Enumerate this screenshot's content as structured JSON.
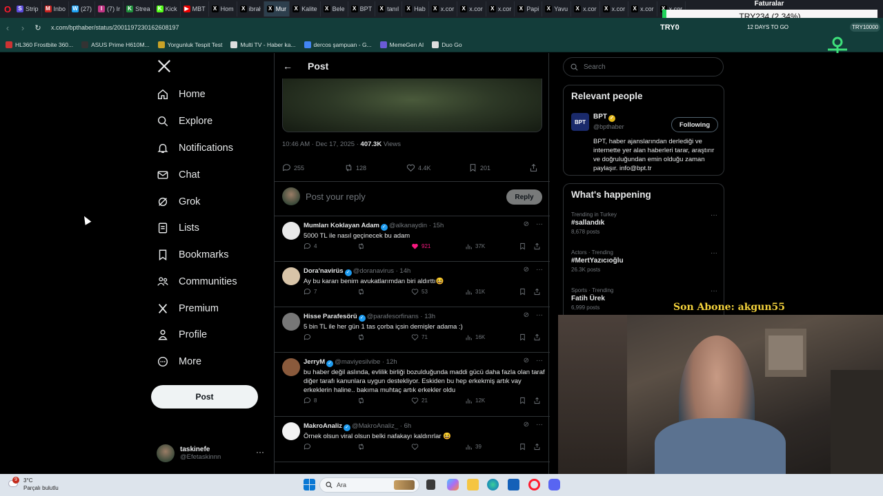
{
  "browser": {
    "tabs": [
      {
        "label": "Strip",
        "color": "#5b4bdb",
        "glyph": "S"
      },
      {
        "label": "Inbo",
        "color": "#c5221f",
        "glyph": "M"
      },
      {
        "label": "(27)",
        "color": "#1da1f2",
        "glyph": "W"
      },
      {
        "label": "(7) Ir",
        "color": "#c13584",
        "glyph": "I"
      },
      {
        "label": "Strea",
        "color": "#1f8f3a",
        "glyph": "K"
      },
      {
        "label": "Kick",
        "color": "#53fc18",
        "glyph": "K"
      },
      {
        "label": "MBT",
        "color": "#e00",
        "glyph": "▶"
      },
      {
        "label": "Hom",
        "color": "#000",
        "glyph": "X"
      },
      {
        "label": "ibrał",
        "color": "#000",
        "glyph": "X"
      },
      {
        "label": "Mur",
        "color": "#000",
        "glyph": "X"
      },
      {
        "label": "Kalite",
        "color": "#000",
        "glyph": "X"
      },
      {
        "label": "Bele",
        "color": "#000",
        "glyph": "X"
      },
      {
        "label": "BPT",
        "color": "#000",
        "glyph": "X"
      },
      {
        "label": "tanıl",
        "color": "#000",
        "glyph": "X"
      },
      {
        "label": "Hab",
        "color": "#000",
        "glyph": "X"
      },
      {
        "label": "x.cor",
        "color": "#000",
        "glyph": "X"
      },
      {
        "label": "x.cor",
        "color": "#000",
        "glyph": "X"
      },
      {
        "label": "x.cor",
        "color": "#000",
        "glyph": "X"
      },
      {
        "label": "Papi",
        "color": "#000",
        "glyph": "X"
      },
      {
        "label": "Yavu",
        "color": "#000",
        "glyph": "X"
      },
      {
        "label": "x.cor",
        "color": "#000",
        "glyph": "X"
      },
      {
        "label": "x.cor",
        "color": "#000",
        "glyph": "X"
      },
      {
        "label": "x.cor",
        "color": "#000",
        "glyph": "X"
      },
      {
        "label": "x.cor",
        "color": "#000",
        "glyph": "X"
      }
    ],
    "active_tab_index": 9,
    "url": "x.com/bpthaber/status/2001197230162608197",
    "bookmarks": [
      {
        "label": "HL360 Frostbite 360...",
        "color": "#c33"
      },
      {
        "label": "ASUS Prime H610M...",
        "color": "#333"
      },
      {
        "label": "Yorgunluk Tespit Test",
        "color": "#c9a227"
      },
      {
        "label": "Multi TV - Haber ka...",
        "color": "#ddd"
      },
      {
        "label": "dercos şampuan - G...",
        "color": "#4285f4"
      },
      {
        "label": "MemeGen AI",
        "color": "#6b5bd6"
      },
      {
        "label": "Duo Go",
        "color": "#ddd"
      }
    ]
  },
  "overlay": {
    "faturalar": "Faturalar",
    "ticker": "TRY234 (2.34%)",
    "tryo": "TRY0",
    "days_to_go": "12 DAYS TO GO",
    "try_rate": "TRY10000",
    "son_abone": "Son Abone: akgun55"
  },
  "sidebar": {
    "items": [
      {
        "label": "Home",
        "icon": "home-icon"
      },
      {
        "label": "Explore",
        "icon": "search-icon"
      },
      {
        "label": "Notifications",
        "icon": "bell-icon"
      },
      {
        "label": "Chat",
        "icon": "mail-icon"
      },
      {
        "label": "Grok",
        "icon": "grok-icon"
      },
      {
        "label": "Lists",
        "icon": "list-icon"
      },
      {
        "label": "Bookmarks",
        "icon": "bookmark-icon"
      },
      {
        "label": "Communities",
        "icon": "people-icon"
      },
      {
        "label": "Premium",
        "icon": "x-icon"
      },
      {
        "label": "Profile",
        "icon": "person-icon"
      },
      {
        "label": "More",
        "icon": "more-circle-icon"
      }
    ],
    "post_label": "Post",
    "account": {
      "name": "taskinefe",
      "handle": "@Efetaskinnn"
    }
  },
  "post": {
    "header": "Post",
    "time": "10:46 AM · Dec 17, 2025 · ",
    "views_count": "407.3K",
    "views_label": " Views",
    "replies": "255",
    "reposts": "128",
    "likes": "4.4K",
    "bookmarks": "201",
    "reply_placeholder": "Post your reply",
    "reply_button": "Reply"
  },
  "replies": [
    {
      "name": "Mumları Koklayan Adam",
      "handle": "@alkanaydin · 15h",
      "text": "5000 TL ile nasıl geçinecek bu adam",
      "comments": "4",
      "reposts": "",
      "likes": "921",
      "liked": true,
      "views": "37K",
      "avatar_color": "#e9e9e9"
    },
    {
      "name": "Dora'navirüs",
      "handle": "@doranavirus · 14h",
      "text": "Ay bu kararı benim avukatlarımdan biri aldırttı😆",
      "comments": "7",
      "reposts": "",
      "likes": "53",
      "liked": false,
      "views": "31K",
      "avatar_color": "#d8c4a8"
    },
    {
      "name": "Hisse Parafesörü",
      "handle": "@parafesorfinans · 13h",
      "text": "5 bin TL ile her gün 1 tas çorba içsin demişler adama :)",
      "comments": "",
      "reposts": "",
      "likes": "71",
      "liked": false,
      "views": "16K",
      "avatar_color": "#777"
    },
    {
      "name": "JerryM",
      "handle": "@maviyesilvibe · 12h",
      "text": "bu haber değil aslında, evlilik birliği bozulduğunda maddi gücü daha fazla olan taraf diğer tarafı kanunlara uygun destekliyor. Eskiden bu hep erkekmiş artık vay erkeklerin haline.. bakıma muhtaç artık erkekler oldu",
      "comments": "8",
      "reposts": "",
      "likes": "21",
      "liked": false,
      "views": "12K",
      "avatar_color": "#8a5a3c"
    },
    {
      "name": "MakroAnaliz",
      "handle": "@MakroAnaliz_ · 6h",
      "text": "Örnek olsun viral olsun belki nafakayı kaldırırlar 😆",
      "comments": "",
      "reposts": "",
      "likes": "",
      "liked": false,
      "views": "39",
      "avatar_color": "#f2f2f2"
    }
  ],
  "right": {
    "search_placeholder": "Search",
    "relevant_title": "Relevant people",
    "person": {
      "name": "BPT",
      "handle": "@bpthaber",
      "follow": "Following",
      "bio": "BPT, haber ajanslarından derlediği ve internette yer alan haberleri tarar, araştırır ve doğruluğundan emin olduğu zaman paylaşır. info@bpt.tr"
    },
    "happening_title": "What's happening",
    "trends": [
      {
        "context": "Trending in Turkey",
        "name": "#sallandık",
        "posts": "8,678 posts"
      },
      {
        "context": "Actors · Trending",
        "name": "#MertYazıcıoğlu",
        "posts": "26.3K posts"
      },
      {
        "context": "Sports · Trending",
        "name": "Fatih Ürek",
        "posts": "6,999 posts"
      }
    ]
  },
  "taskbar": {
    "badge": "9",
    "temp": "3°C",
    "weather": "Parçalı bulutlu",
    "search": "Ara"
  }
}
